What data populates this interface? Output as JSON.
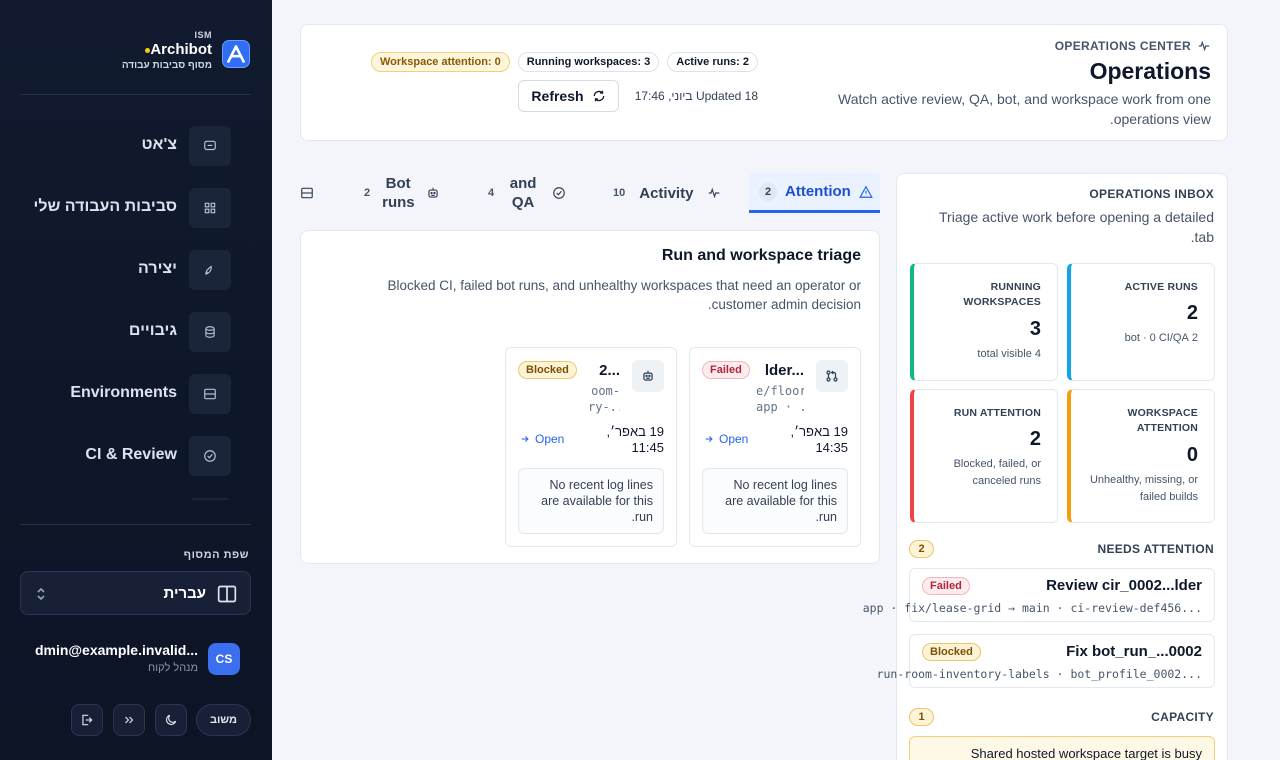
{
  "brand": {
    "top": "ISM",
    "name": "Archibot",
    "subtitle": "מסוף סביבות עבודה"
  },
  "nav": [
    {
      "label": "צ'אט",
      "icon": "chat-icon"
    },
    {
      "label": "סביבות העבודה שלי",
      "icon": "grid-icon"
    },
    {
      "label": "יצירה",
      "icon": "rocket-icon"
    },
    {
      "label": "גיבויים",
      "icon": "database-icon"
    },
    {
      "label": "Environments",
      "icon": "server-icon"
    },
    {
      "label": "CI & Review",
      "icon": "check-circle-icon"
    }
  ],
  "language": {
    "title": "שפת המסוף",
    "value": "עברית"
  },
  "user": {
    "initials": "CS",
    "email": "dmin@example.invalid...",
    "role": "מנהל לקוח"
  },
  "footer": {
    "feedback_label": "משוב"
  },
  "header": {
    "section_label": "OPERATIONS CENTER",
    "title": "Operations",
    "description": "Watch active review, QA, bot, and workspace work from one operations view.",
    "pills": {
      "workspace_attention": "Workspace attention: 0",
      "running_workspaces": "Running workspaces: 3",
      "active_runs": "Active runs: 2"
    },
    "updated": "Updated 18 ביוני, 17:46",
    "refresh_label": "Refresh"
  },
  "tabs": [
    {
      "label": "Attention",
      "count": "2",
      "icon": "warning-icon",
      "active": true
    },
    {
      "label": "Activity",
      "count": "10",
      "icon": "pulse-icon"
    },
    {
      "label": "and QA",
      "count": "4",
      "icon": "check-circle-icon"
    },
    {
      "label": "Bot runs",
      "count": "2",
      "icon": "bot-icon"
    }
  ],
  "triage": {
    "title": "Run and workspace triage",
    "description": "Blocked CI, failed bot runs, and unhealthy workspaces that need an operator or customer admin decision.",
    "cards": [
      {
        "title": "lder...",
        "sub1": "e/floor-",
        "sub2": "app · ...",
        "status": "Failed",
        "date": "19 באפר׳, 14:35",
        "open_label": "Open",
        "log": "No recent log lines are available for this run.",
        "icon": "git-pull-request-icon"
      },
      {
        "title": "2...",
        "sub1": "oom-",
        "sub2": "ry-...",
        "status": "Blocked",
        "date": "19 באפר׳, 11:45",
        "open_label": "Open",
        "log": "No recent log lines are available for this run.",
        "icon": "bot-icon"
      }
    ]
  },
  "inbox": {
    "label": "OPERATIONS INBOX",
    "description": "Triage active work before opening a detailed tab.",
    "stats": [
      {
        "label": "ACTIVE RUNS",
        "value": "2",
        "note": "2 bot · 0 CI/QA",
        "accent": "#0ea5e9"
      },
      {
        "label": "RUNNING WORKSPACES",
        "value": "3",
        "note": "4 total visible",
        "accent": "#10b981"
      },
      {
        "label": "WORKSPACE ATTENTION",
        "value": "0",
        "note": "Unhealthy, missing, or failed builds",
        "accent": "#f59e0b"
      },
      {
        "label": "RUN ATTENTION",
        "value": "2",
        "note": "Blocked, failed, or canceled runs",
        "accent": "#ef4444"
      }
    ],
    "needs_attention": {
      "title": "NEEDS ATTENTION",
      "count": "2",
      "items": [
        {
          "title": "Review cir_0002...lder",
          "status": "Failed",
          "sub": "app · fix/lease-grid → main · ci-review-def456..."
        },
        {
          "title": "Fix bot_run_...0002",
          "status": "Blocked",
          "sub": "run-room-inventory-labels · bot_profile_0002..."
        }
      ]
    },
    "capacity": {
      "title": "CAPACITY",
      "count": "1",
      "item": "Shared hosted workspace target is busy"
    }
  }
}
